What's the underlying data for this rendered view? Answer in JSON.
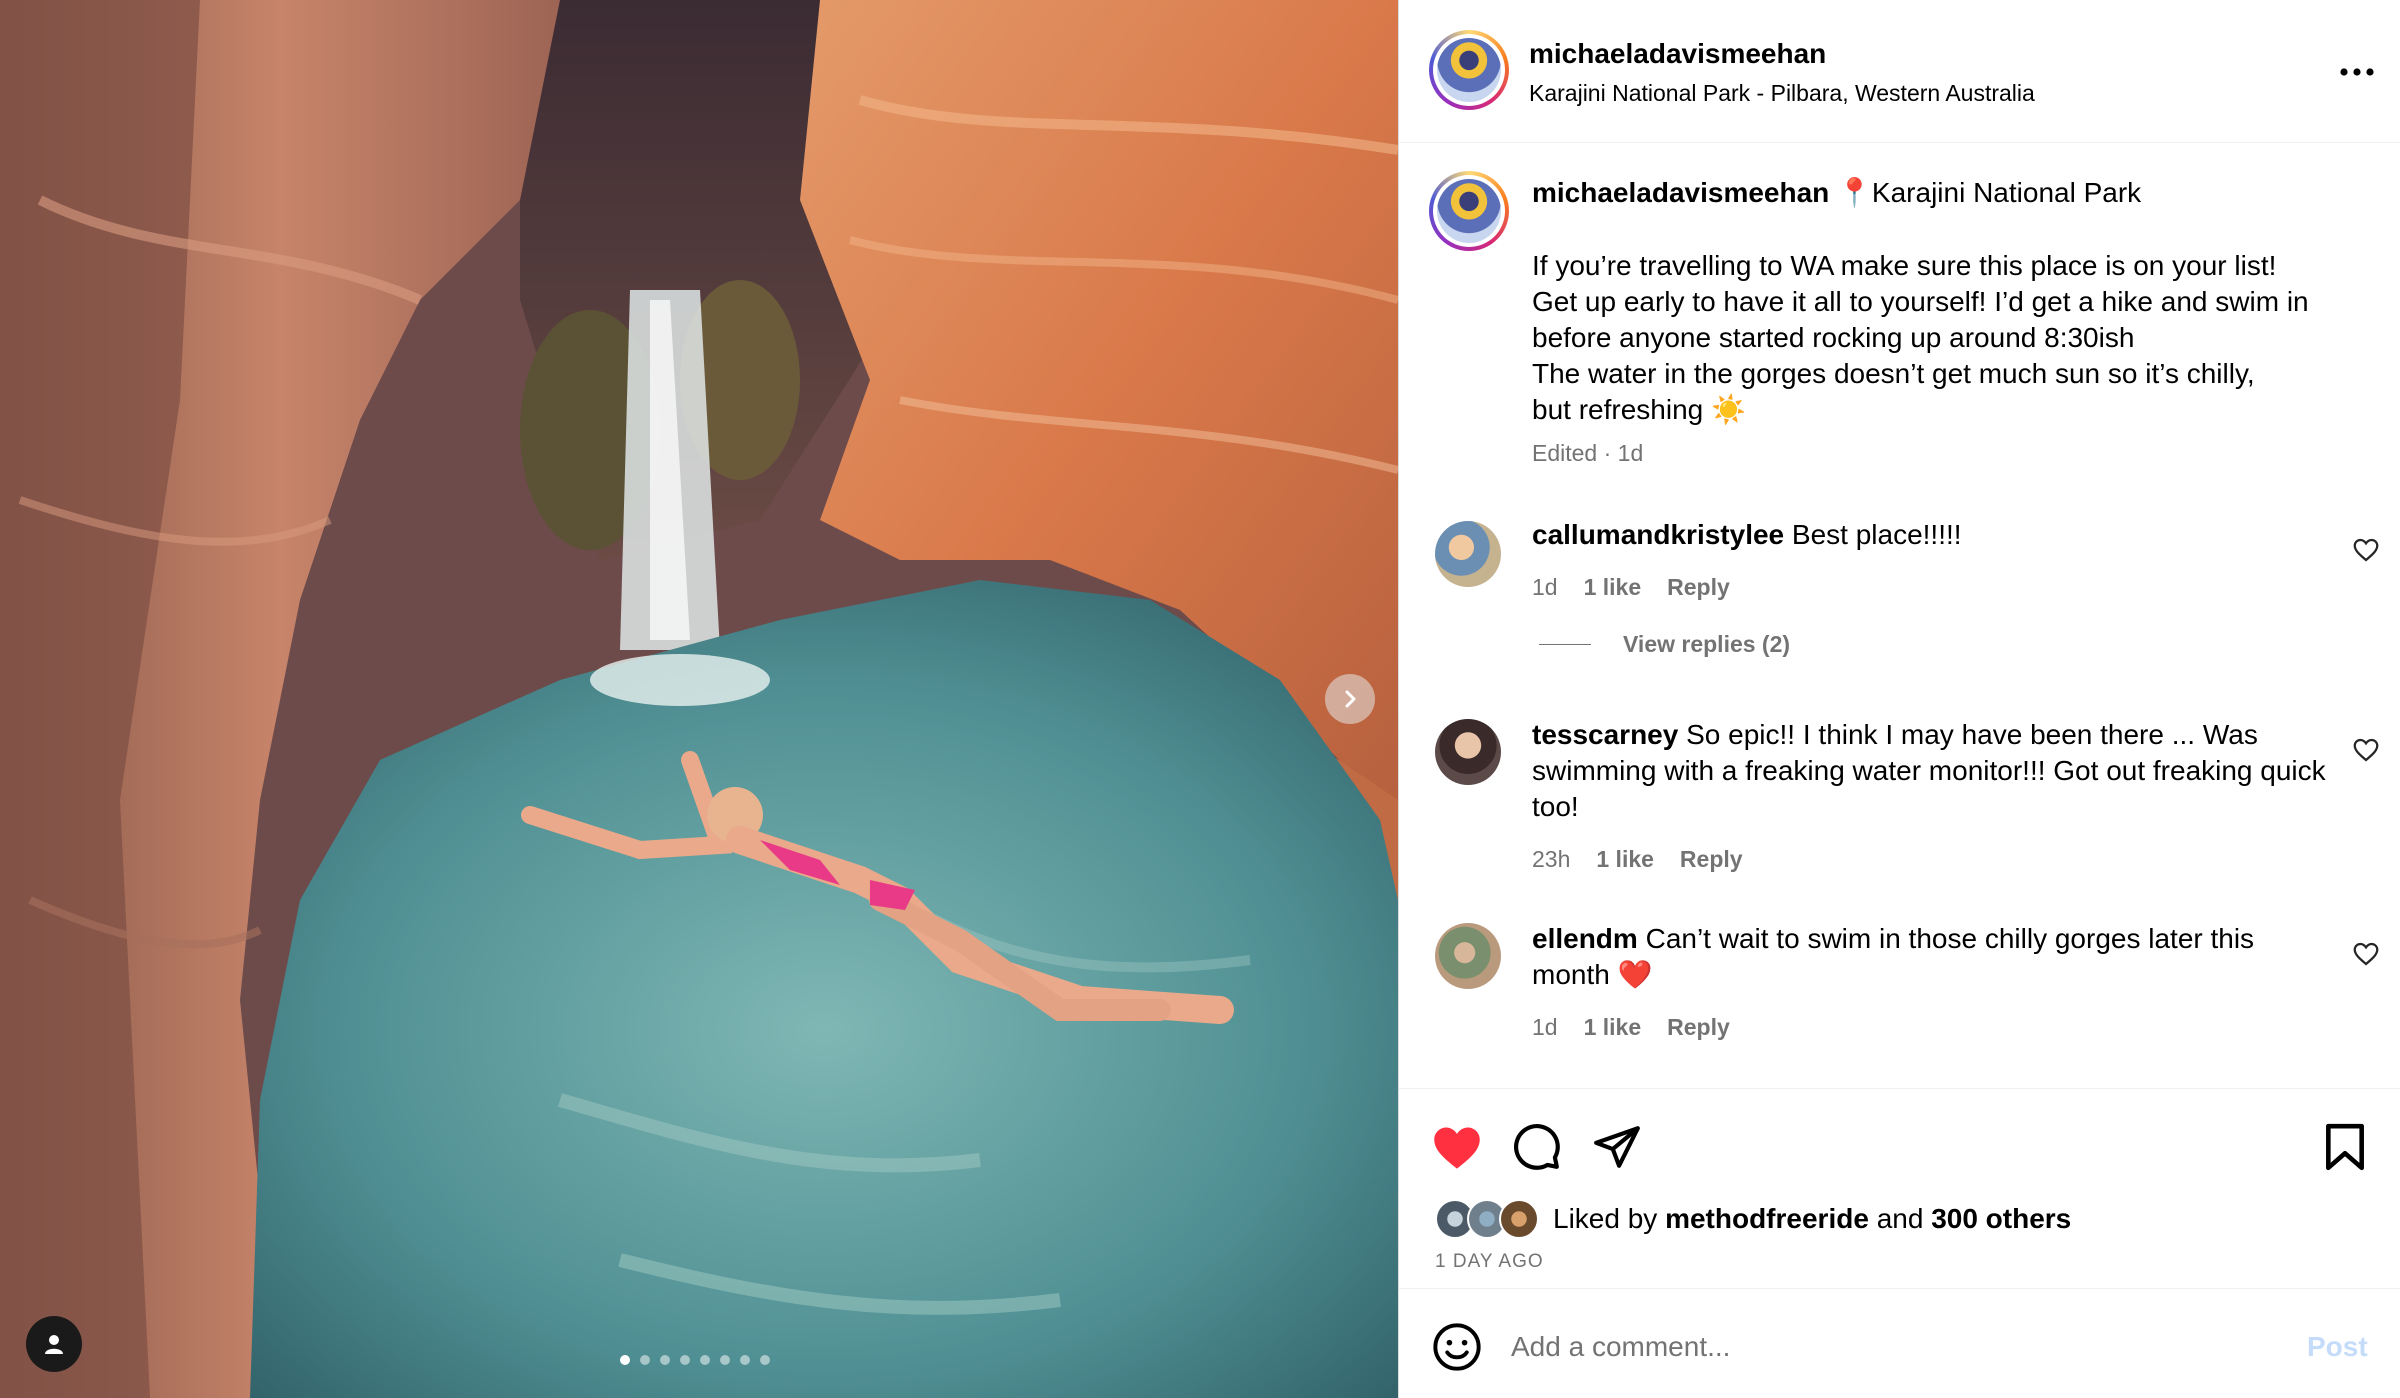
{
  "post": {
    "username": "michaeladavismeehan",
    "location": "Karajini National Park - Pilbara, Western Australia",
    "more_icon": "more-horizontal-icon",
    "carousel": {
      "slide_count": 8,
      "active_index": 0,
      "next_icon": "chevron-right-icon",
      "tag_icon": "user-tag-icon"
    }
  },
  "caption": {
    "username": "michaeladavismeehan",
    "location_tag": "📍Karajini National Park",
    "lines": [
      "If you’re travelling to WA make sure this place is on your list!",
      "Get up early to have it all to yourself! I’d get a hike and swim in",
      "before anyone started rocking up around 8:30ish",
      "The water in the gorges doesn’t get much sun so it’s chilly,",
      "but refreshing ☀️"
    ],
    "meta": "Edited · 1d"
  },
  "comments": [
    {
      "username": "callumandkristylee",
      "text": "Best place!!!!!",
      "time": "1d",
      "likes": "1 like",
      "reply": "Reply"
    },
    {
      "username": "tesscarney",
      "text": "So epic!! I think I may have been there ... Was swimming with a freaking water monitor!!! Got out freaking quick too!",
      "time": "23h",
      "likes": "1 like",
      "reply": "Reply"
    },
    {
      "username": "ellendm",
      "text": "Can’t wait to swim in those chilly gorges later this month ❤️",
      "time": "1d",
      "likes": "1 like",
      "reply": "Reply"
    }
  ],
  "view_replies": "View replies (2)",
  "actions": {
    "like_icon": "heart-filled-icon",
    "comment_icon": "comment-icon",
    "share_icon": "send-icon",
    "save_icon": "bookmark-icon",
    "like_color": "#ff3040"
  },
  "likes": {
    "prefix": "Liked by",
    "user": "methodfreeride",
    "conjunction": "and",
    "others": "300 others"
  },
  "time_ago": "1 DAY AGO",
  "add_comment": {
    "placeholder": "Add a comment...",
    "post_label": "Post",
    "emoji_icon": "smiley-icon"
  }
}
